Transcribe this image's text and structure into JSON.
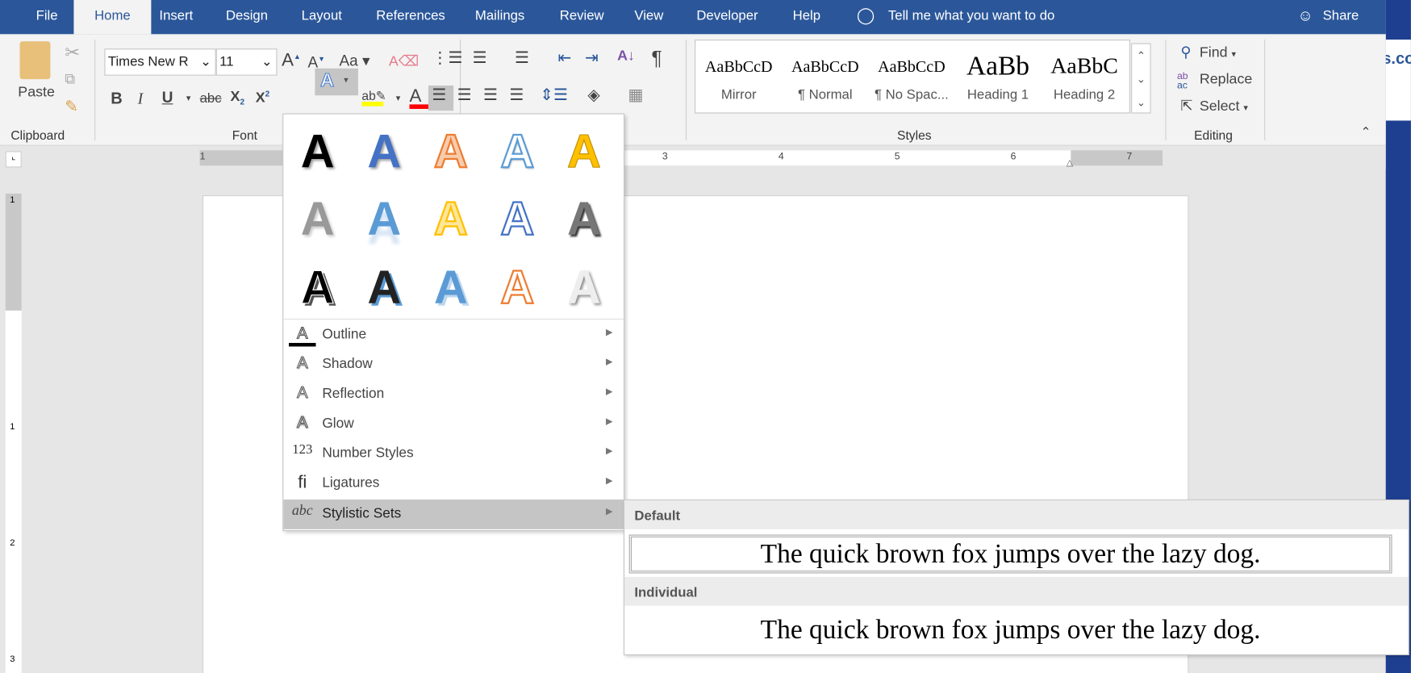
{
  "tabs": [
    "File",
    "Home",
    "Insert",
    "Design",
    "Layout",
    "References",
    "Mailings",
    "Review",
    "View",
    "Developer",
    "Help"
  ],
  "tell_me": "Tell me what you want to do",
  "share": "Share",
  "right_strip_text": "s.co",
  "clipboard": {
    "paste": "Paste",
    "label": "Clipboard"
  },
  "font": {
    "name": "Times New R",
    "size": "11",
    "label": "Font",
    "change_case": "Aa",
    "bold": "B",
    "italic": "I",
    "underline": "U",
    "strike": "abc",
    "sub": "X",
    "sup": "X"
  },
  "styles": {
    "label": "Styles",
    "items": [
      {
        "preview": "AaBbCcD",
        "name": "Mirror"
      },
      {
        "preview": "AaBbCcD",
        "name": "¶ Normal"
      },
      {
        "preview": "AaBbCcD",
        "name": "¶ No Spac..."
      },
      {
        "preview": "AaBb",
        "name": "Heading 1"
      },
      {
        "preview": "AaBbC",
        "name": "Heading 2"
      }
    ]
  },
  "editing": {
    "find": "Find",
    "replace": "Replace",
    "select": "Select",
    "label": "Editing"
  },
  "ruler": {
    "numbers": [
      "1",
      "3",
      "4",
      "5",
      "6",
      "7"
    ],
    "vnumbers": [
      "1",
      "1",
      "2",
      "3"
    ]
  },
  "text_effects_menu": {
    "gallery": [
      "A",
      "A",
      "A",
      "A",
      "A",
      "A",
      "A",
      "A",
      "A",
      "A",
      "A",
      "A",
      "A",
      "A",
      "A"
    ],
    "items": [
      {
        "icon": "A",
        "label": "Outline"
      },
      {
        "icon": "A",
        "label": "Shadow"
      },
      {
        "icon": "A",
        "label": "Reflection"
      },
      {
        "icon": "A",
        "label": "Glow"
      },
      {
        "icon": "123",
        "label": "Number Styles"
      },
      {
        "icon": "fi",
        "label": "Ligatures"
      },
      {
        "icon": "abc",
        "label": "Stylistic Sets"
      }
    ]
  },
  "stylistic_sets": {
    "default_header": "Default",
    "default_sample": "The quick brown fox jumps over the lazy dog.",
    "individual_header": "Individual",
    "individual_sample": "The quick brown fox jumps over the lazy dog."
  },
  "colors": {
    "brand": "#2b579a",
    "highlight": "#ffff00",
    "font_color": "#ff0000"
  }
}
